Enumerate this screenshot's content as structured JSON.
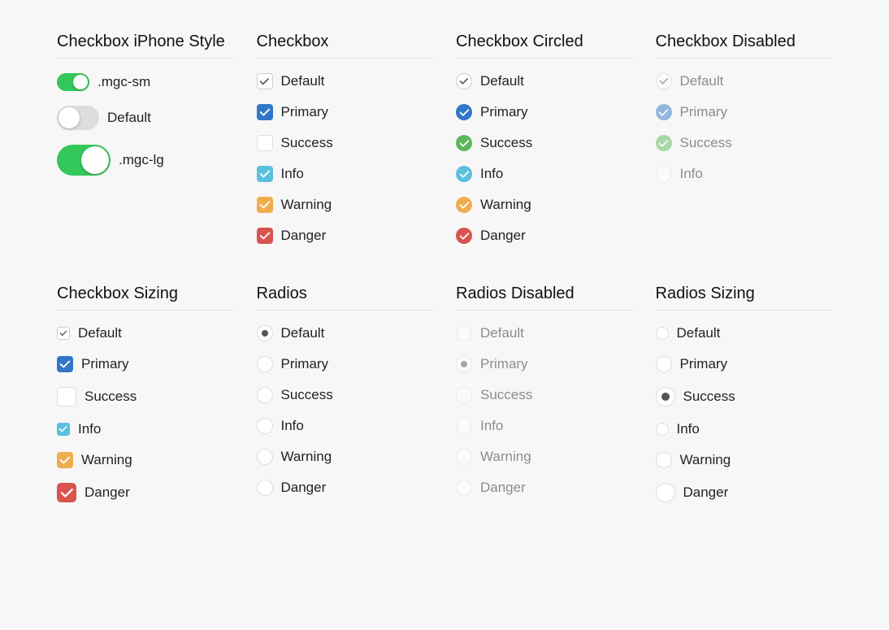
{
  "colors": {
    "default": "#ffffff",
    "primary": "#3177c7",
    "success": "#5cb85c",
    "info": "#5bc0de",
    "warning": "#f0ad4e",
    "danger": "#d9534f",
    "toggle_on": "#34c759"
  },
  "panels": {
    "iphone": {
      "title": "Checkbox iPhone Style",
      "items": [
        {
          "label": ".mgc-sm",
          "size": "sm",
          "on": true
        },
        {
          "label": "Default",
          "size": "md",
          "on": false
        },
        {
          "label": ".mgc-lg",
          "size": "lg",
          "on": true
        }
      ]
    },
    "checkbox": {
      "title": "Checkbox",
      "items": [
        {
          "label": "Default",
          "variant": "default",
          "checked": true
        },
        {
          "label": "Primary",
          "variant": "primary",
          "checked": true
        },
        {
          "label": "Success",
          "variant": "success",
          "checked": false
        },
        {
          "label": "Info",
          "variant": "info",
          "checked": true
        },
        {
          "label": "Warning",
          "variant": "warning",
          "checked": true
        },
        {
          "label": "Danger",
          "variant": "danger",
          "checked": true
        }
      ]
    },
    "checkbox_circled": {
      "title": "Checkbox Circled",
      "items": [
        {
          "label": "Default",
          "variant": "default",
          "checked": true
        },
        {
          "label": "Primary",
          "variant": "primary",
          "checked": true
        },
        {
          "label": "Success",
          "variant": "success",
          "checked": true
        },
        {
          "label": "Info",
          "variant": "info",
          "checked": true
        },
        {
          "label": "Warning",
          "variant": "warning",
          "checked": true
        },
        {
          "label": "Danger",
          "variant": "danger",
          "checked": true
        }
      ]
    },
    "checkbox_disabled": {
      "title": "Checkbox Disabled",
      "items": [
        {
          "label": "Default",
          "variant": "default",
          "checked": true
        },
        {
          "label": "Primary",
          "variant": "primary",
          "checked": true
        },
        {
          "label": "Success",
          "variant": "success",
          "checked": true
        },
        {
          "label": "Info",
          "variant": "info",
          "checked": false
        }
      ]
    },
    "checkbox_sizing": {
      "title": "Checkbox Sizing",
      "items": [
        {
          "label": "Default",
          "variant": "default",
          "checked": true,
          "size": "sm"
        },
        {
          "label": "Primary",
          "variant": "primary",
          "checked": true,
          "size": "md"
        },
        {
          "label": "Success",
          "variant": "success",
          "checked": false,
          "size": "lg"
        },
        {
          "label": "Info",
          "variant": "info",
          "checked": true,
          "size": "sm"
        },
        {
          "label": "Warning",
          "variant": "warning",
          "checked": true,
          "size": "md"
        },
        {
          "label": "Danger",
          "variant": "danger",
          "checked": true,
          "size": "lg"
        }
      ]
    },
    "radios": {
      "title": "Radios",
      "items": [
        {
          "label": "Default",
          "checked": true
        },
        {
          "label": "Primary",
          "checked": false
        },
        {
          "label": "Success",
          "checked": false
        },
        {
          "label": "Info",
          "checked": false
        },
        {
          "label": "Warning",
          "checked": false
        },
        {
          "label": "Danger",
          "checked": false
        }
      ]
    },
    "radios_disabled": {
      "title": "Radios Disabled",
      "items": [
        {
          "label": "Default",
          "checked": false
        },
        {
          "label": "Primary",
          "checked": true
        },
        {
          "label": "Success",
          "checked": false
        },
        {
          "label": "Info",
          "checked": false
        },
        {
          "label": "Warning",
          "checked": false
        },
        {
          "label": "Danger",
          "checked": false
        }
      ]
    },
    "radios_sizing": {
      "title": "Radios Sizing",
      "items": [
        {
          "label": "Default",
          "checked": false,
          "size": "sm"
        },
        {
          "label": "Primary",
          "checked": false,
          "size": "md"
        },
        {
          "label": "Success",
          "checked": true,
          "size": "lg"
        },
        {
          "label": "Info",
          "checked": false,
          "size": "sm"
        },
        {
          "label": "Warning",
          "checked": false,
          "size": "md"
        },
        {
          "label": "Danger",
          "checked": false,
          "size": "lg"
        }
      ]
    }
  }
}
